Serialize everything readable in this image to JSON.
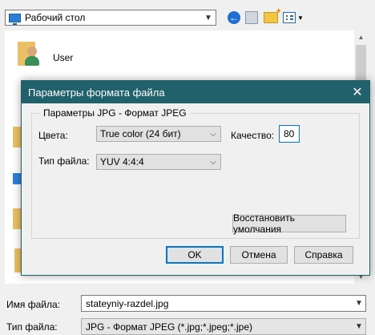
{
  "toolbar": {
    "location": "Рабочий стол",
    "icons": [
      "back-icon",
      "up-folder-icon",
      "new-folder-icon",
      "views-menu-icon"
    ]
  },
  "file_list": {
    "items": [
      {
        "name": "User",
        "icon": "user-folder-icon"
      }
    ]
  },
  "bottom": {
    "filename_label": "Имя файла:",
    "filename_value": "stateyniy-razdel.jpg",
    "filetype_label": "Тип файла:",
    "filetype_value": "JPG - Формат JPEG (*.jpg;*.jpeg;*.jpe)"
  },
  "modal": {
    "title": "Параметры формата файла",
    "group_title": "Параметры JPG - Формат JPEG",
    "colors_label": "Цвета:",
    "colors_value": "True color (24 бит)",
    "quality_label": "Качество:",
    "quality_value": "80",
    "filetype_label": "Тип файла:",
    "filetype_value": "YUV 4:4:4",
    "restore_button": "Восстановить умолчания",
    "ok_button": "OK",
    "cancel_button": "Отмена",
    "help_button": "Справка"
  },
  "colors": {
    "titlebar": "#20616c",
    "focus": "#0078d7"
  }
}
